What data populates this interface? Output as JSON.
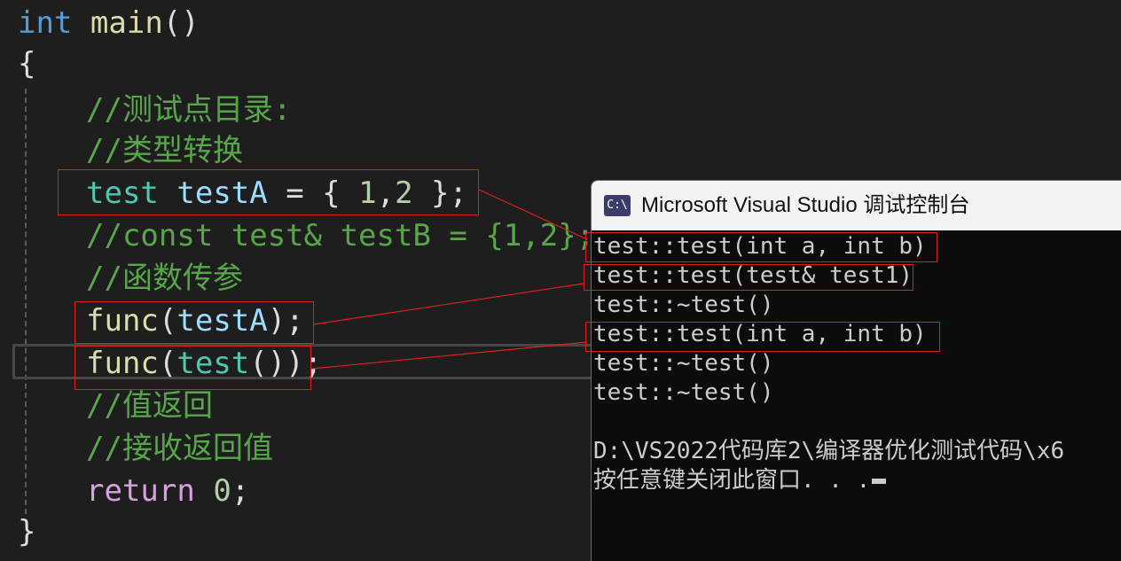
{
  "editor": {
    "l1": {
      "kw": "int",
      "fn": "main",
      "paren": "()"
    },
    "l2": {
      "brace": "{"
    },
    "l3": {
      "comment": "//测试点目录:"
    },
    "l4": {
      "comment": "//类型转换"
    },
    "l5": {
      "type": "test",
      "var": "testA",
      "rest1": " = { ",
      "n1": "1",
      "comma": ",",
      "n2": "2",
      "rest2": " };"
    },
    "l6": {
      "comment": "//const test& testB = {1,2};"
    },
    "l7": {
      "comment": "//函数传参"
    },
    "l8": {
      "fn": "func",
      "open": "(",
      "var": "testA",
      "close": ");"
    },
    "l9": {
      "fn": "func",
      "open": "(",
      "type": "test",
      "mid": "()",
      "close": ");"
    },
    "l10": {
      "comment": "//值返回"
    },
    "l11": {
      "comment": "//接收返回值"
    },
    "l12": {
      "kw": "return",
      "num": "0",
      "semi": ";"
    },
    "l13": {
      "brace": "}"
    }
  },
  "console": {
    "icon": "C:\\",
    "title": "Microsoft Visual Studio 调试控制台",
    "lines": [
      "test::test(int a, int b)",
      "test::test(test& test1)",
      "test::~test()",
      "test::test(int a, int b)",
      "test::~test()",
      "test::~test()",
      "",
      "D:\\VS2022代码库2\\编译器优化测试代码\\x6",
      "按任意键关闭此窗口. . ."
    ]
  }
}
